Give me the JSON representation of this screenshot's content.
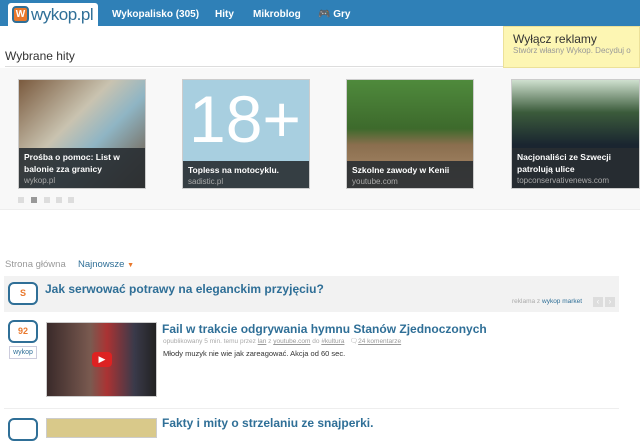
{
  "header": {
    "logo": "wykop.pl",
    "nav": [
      "Wykopalisko (305)",
      "Hity",
      "Mikroblog",
      "Gry"
    ]
  },
  "ad_box": {
    "title": "Wyłącz reklamy",
    "subtitle": "Stwórz własny Wykop. Decyduj o"
  },
  "featured": {
    "title": "Wybrane hity",
    "cards": [
      {
        "title": "Prośba o pomoc: List w balonie zza granicy",
        "source": "wykop.pl"
      },
      {
        "title": "Topless na motocyklu.",
        "source": "sadistic.pl",
        "image_text": "18+"
      },
      {
        "title": "Szkolne zawody w Kenii",
        "source": "youtube.com"
      },
      {
        "title": "Nacjonaliści ze Szwecji patrolują ulice",
        "source": "topconservativenews.com"
      }
    ],
    "active_dot": 1
  },
  "breadcrumb": {
    "home": "Strona główna",
    "sort": "Najnowsze"
  },
  "sponsored": {
    "score": "S",
    "title": "Jak serwować potrawy na eleganckim przyjęciu?",
    "label": "reklama z",
    "label_link": "wykop market"
  },
  "items": [
    {
      "score": "92",
      "button": "wykop",
      "title": "Fail w trakcie odgrywania hymnu Stanów Zjednoczonych",
      "meta_prefix": "opublikowany 5 min. temu przez",
      "author": "lan",
      "meta_from": "z",
      "domain": "youtube.com",
      "meta_to": "do",
      "tag": "#kultura",
      "comments": "24 komentarze",
      "description": "Młody muzyk nie wie jak zareagować. Akcja od 60 sec."
    },
    {
      "title": "Fakty i mity o strzelaniu ze snajperki."
    }
  ]
}
